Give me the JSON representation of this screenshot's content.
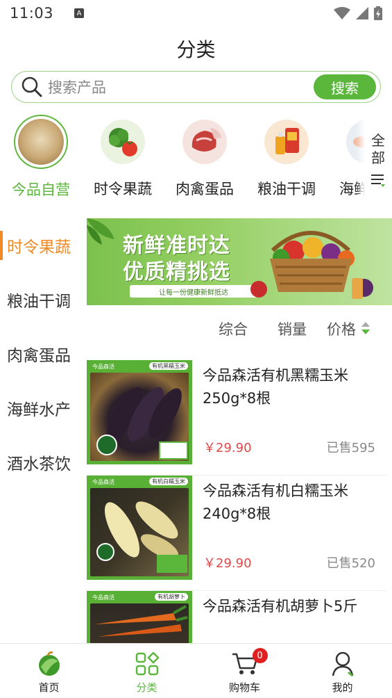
{
  "status_bar": {
    "time": "11:03",
    "notification_glyph": "A"
  },
  "header": {
    "title": "分类"
  },
  "search": {
    "placeholder": "搜索产品",
    "button_label": "搜索"
  },
  "categories": [
    {
      "label": "今品自营",
      "icon": "own-brand-products-icon",
      "active": true
    },
    {
      "label": "时令果蔬",
      "icon": "vegetables-icon",
      "active": false
    },
    {
      "label": "肉禽蛋品",
      "icon": "meat-icon",
      "active": false
    },
    {
      "label": "粮油干调",
      "icon": "grain-oil-icon",
      "active": false
    },
    {
      "label": "海鲜水产",
      "icon": "seafood-icon",
      "active": false
    }
  ],
  "all_button": {
    "label_line1": "全",
    "label_line2": "部"
  },
  "left_nav": [
    {
      "label": "时令果蔬",
      "active": true
    },
    {
      "label": "粮油干调",
      "active": false
    },
    {
      "label": "肉禽蛋品",
      "active": false
    },
    {
      "label": "海鲜水产",
      "active": false
    },
    {
      "label": "酒水茶饮",
      "active": false
    }
  ],
  "banner": {
    "line1": "新鲜准时达",
    "line2": "优质精挑选",
    "subtitle": "让每一份健康新鲜抵达"
  },
  "sort": {
    "comprehensive": "综合",
    "sales": "销量",
    "price": "价格"
  },
  "products": [
    {
      "name": "今品森活有机黑糯玉米250g*8根",
      "price": "￥29.90",
      "sold": "已售595",
      "brand_tag": "今品森活",
      "label_tag": "有机黑糯玉米",
      "image": "black-corn"
    },
    {
      "name": "今品森活有机白糯玉米240g*8根",
      "price": "￥29.90",
      "sold": "已售520",
      "brand_tag": "今品森活",
      "label_tag": "有机白糯玉米",
      "image": "white-corn"
    },
    {
      "name": "今品森活有机胡萝卜5斤",
      "price": "",
      "sold": "",
      "brand_tag": "今品森活",
      "label_tag": "有机胡萝卜",
      "image": "carrot"
    }
  ],
  "tab_bar": [
    {
      "label": "首页",
      "icon": "home-logo-icon",
      "active": false
    },
    {
      "label": "分类",
      "icon": "category-grid-icon",
      "active": true
    },
    {
      "label": "购物车",
      "icon": "cart-icon",
      "active": false,
      "badge": "0"
    },
    {
      "label": "我的",
      "icon": "user-icon",
      "active": false
    }
  ],
  "colors": {
    "accent_green": "#5bb63c",
    "nav_active_orange": "#f08a24",
    "price_red": "#e04848",
    "badge_red": "#e02020"
  }
}
